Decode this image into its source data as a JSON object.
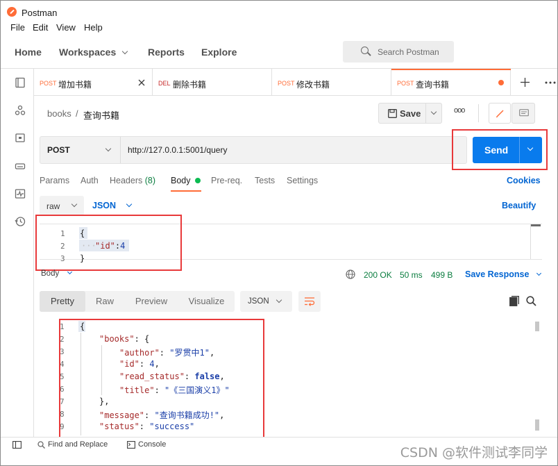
{
  "window": {
    "title": "Postman"
  },
  "menu": [
    "File",
    "Edit",
    "View",
    "Help"
  ],
  "nav": {
    "home": "Home",
    "workspaces": "Workspaces",
    "reports": "Reports",
    "explore": "Explore"
  },
  "search": {
    "placeholder": "Search Postman"
  },
  "tabs": [
    {
      "method": "POST",
      "name": "增加书籍"
    },
    {
      "method": "DEL",
      "name": "删除书籍"
    },
    {
      "method": "POST",
      "name": "修改书籍"
    },
    {
      "method": "POST",
      "name": "查询书籍"
    }
  ],
  "breadcrumb": {
    "collection": "books",
    "separator": "/",
    "request": "查询书籍"
  },
  "toolbar": {
    "save_label": "Save",
    "more": "ooo"
  },
  "request": {
    "method": "POST",
    "url": "http://127.0.0.1:5001/query",
    "send_label": "Send"
  },
  "request_tabs": {
    "params": "Params",
    "auth": "Auth",
    "headers": "Headers",
    "headers_count": "(8)",
    "body": "Body",
    "prereq": "Pre-req.",
    "tests": "Tests",
    "settings": "Settings",
    "cookies": "Cookies"
  },
  "body_options": {
    "mode": "raw",
    "format": "JSON",
    "beautify": "Beautify"
  },
  "request_body_lines": [
    {
      "num": "1",
      "text": "{"
    },
    {
      "num": "2",
      "key": "\"id\"",
      "value": "4"
    },
    {
      "num": "3",
      "text": "}"
    }
  ],
  "response_header": {
    "label": "Body",
    "status": "200 OK",
    "time": "50 ms",
    "size": "499 B",
    "save_response": "Save Response"
  },
  "response_views": {
    "pretty": "Pretty",
    "raw": "Raw",
    "preview": "Preview",
    "visualize": "Visualize",
    "format": "JSON"
  },
  "response_lines": {
    "l1": "{",
    "l2_key": "\"books\"",
    "l2_rest": ": {",
    "l3_key": "\"author\"",
    "l3_val": "\"罗贯中1\"",
    "l4_key": "\"id\"",
    "l4_val": "4",
    "l5_key": "\"read_status\"",
    "l5_val": "false",
    "l6_key": "\"title\"",
    "l6_val": "\"《三国演义1》\"",
    "l7": "},",
    "l8_key": "\"message\"",
    "l8_val": "\"查询书籍成功!\"",
    "l9_key": "\"status\"",
    "l9_val": "\"success\""
  },
  "statusbar": {
    "find_replace": "Find and Replace",
    "console": "Console"
  },
  "watermark": "CSDN @软件测试李同学",
  "colors": {
    "accent": "#ff6c37",
    "send": "#097bed",
    "highlight": "#e8393a",
    "link": "#0265d2",
    "status_ok": "#0a7d3f"
  }
}
